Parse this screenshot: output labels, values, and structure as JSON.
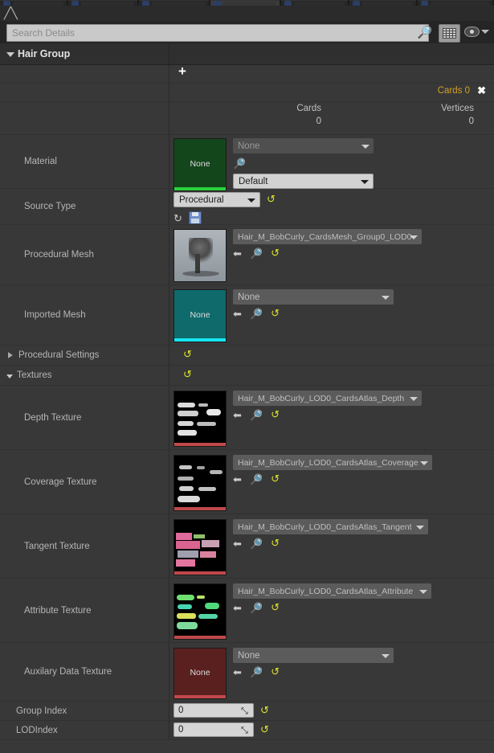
{
  "window": {
    "app_icon": "groom-icon",
    "tabs": [
      {
        "label": "",
        "active": false
      },
      {
        "label": "",
        "active": false
      },
      {
        "label": "",
        "active": false
      },
      {
        "label": "",
        "active": true
      },
      {
        "label": "",
        "active": false
      },
      {
        "label": "",
        "active": false
      },
      {
        "label": "",
        "active": false
      }
    ]
  },
  "toolbar": {
    "search_placeholder": "Search Details",
    "search_value": "",
    "search_icon": "search-icon",
    "grid_button_icon": "grid-view-icon",
    "eye_button_icon": "eye-icon",
    "eye_chevron_icon": "chevron-down-icon"
  },
  "category": {
    "label": "Hair Group",
    "expanded": true,
    "expander_icon": "triangle-down-icon"
  },
  "cards_header": {
    "add_icon": "plus-icon",
    "tag_label": "Cards 0",
    "close_icon": "close-icon",
    "tag_color": "#d2a02a"
  },
  "stats": {
    "columns": [
      {
        "header": "Cards",
        "value": "0"
      },
      {
        "header": "Vertices",
        "value": "0"
      }
    ]
  },
  "rows": {
    "material": {
      "label": "Material",
      "thumbnail_label": "None",
      "thumbnail_color": "#14461b",
      "thumbnail_bar_color": "#2ad33c",
      "asset_value": "None",
      "search_icon": "magnifier-icon",
      "slot_value": "Default"
    },
    "source_type": {
      "label": "Source Type",
      "value": "Procedural",
      "reset_icon": "reset-arrow-icon",
      "refresh_icon": "refresh-icon",
      "save_icon": "save-icon"
    },
    "procedural_mesh": {
      "label": "Procedural Mesh",
      "asset_value": "Hair_M_BobCurly_CardsMesh_Group0_LOD0",
      "browse_icon": "arrow-left-icon",
      "search_icon": "magnifier-icon",
      "reset_icon": "reset-arrow-icon"
    },
    "imported_mesh": {
      "label": "Imported Mesh",
      "thumbnail_label": "None",
      "thumbnail_color": "#0f6a6c",
      "thumbnail_bar_color": "#17e6ef",
      "asset_value": "None",
      "browse_icon": "arrow-left-icon",
      "search_icon": "magnifier-icon",
      "reset_icon": "reset-arrow-icon"
    },
    "procedural_settings": {
      "label": "Procedural Settings",
      "expanded": false,
      "expander_icon": "triangle-right-icon",
      "reset_icon": "reset-arrow-icon"
    },
    "textures": {
      "label": "Textures",
      "expanded": true,
      "expander_icon": "triangle-down-icon",
      "reset_icon": "reset-arrow-icon"
    },
    "group_index": {
      "label": "Group Index",
      "value": "0",
      "reset_icon": "reset-arrow-icon"
    },
    "lod_index": {
      "label": "LODIndex",
      "value": "0",
      "reset_icon": "reset-arrow-icon"
    }
  },
  "textures": [
    {
      "label": "Depth Texture",
      "asset_value": "Hair_M_BobCurly_LOD0_CardsAtlas_Depth",
      "thumbnail_style": "depth",
      "browse_icon": "arrow-left-icon",
      "search_icon": "magnifier-icon",
      "reset_icon": "reset-arrow-icon"
    },
    {
      "label": "Coverage Texture",
      "asset_value": "Hair_M_BobCurly_LOD0_CardsAtlas_Coverage",
      "thumbnail_style": "coverage",
      "browse_icon": "arrow-left-icon",
      "search_icon": "magnifier-icon",
      "reset_icon": "reset-arrow-icon"
    },
    {
      "label": "Tangent Texture",
      "asset_value": "Hair_M_BobCurly_LOD0_CardsAtlas_Tangent",
      "thumbnail_style": "tangent",
      "browse_icon": "arrow-left-icon",
      "search_icon": "magnifier-icon",
      "reset_icon": "reset-arrow-icon"
    },
    {
      "label": "Attribute Texture",
      "asset_value": "Hair_M_BobCurly_LOD0_CardsAtlas_Attribute",
      "thumbnail_style": "attribute",
      "browse_icon": "arrow-left-icon",
      "search_icon": "magnifier-icon",
      "reset_icon": "reset-arrow-icon"
    },
    {
      "label": "Auxilary Data Texture",
      "asset_value": "None",
      "thumbnail_style": "none-red",
      "thumbnail_label": "None",
      "browse_icon": "arrow-left-icon",
      "search_icon": "magnifier-icon",
      "reset_icon": "reset-arrow-icon"
    }
  ]
}
